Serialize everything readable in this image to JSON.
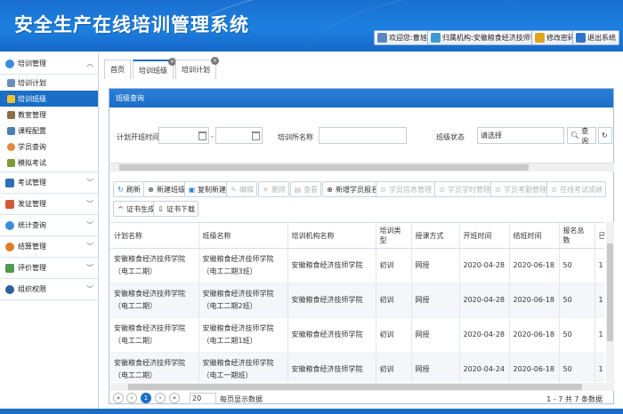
{
  "app": {
    "title": "安全生产在线培训管理系统"
  },
  "header": {
    "welcome": "欢迎您:曹旭红",
    "org": "归属机构:安徽粮食经济技师学院",
    "change_password": "修改密码",
    "logout": "退出系统"
  },
  "sidebar": {
    "groups": [
      {
        "label": "培训管理",
        "icon": "training-icon"
      },
      {
        "label": "考试管理",
        "icon": "exam-icon"
      },
      {
        "label": "发证管理",
        "icon": "certificate-icon"
      },
      {
        "label": "统计查询",
        "icon": "statistics-icon"
      },
      {
        "label": "结算管理",
        "icon": "settlement-icon"
      },
      {
        "label": "评价管理",
        "icon": "evaluation-icon"
      },
      {
        "label": "组织权限",
        "icon": "organization-icon"
      }
    ],
    "sub_items": [
      {
        "label": "培训计划",
        "active": false
      },
      {
        "label": "培训班级",
        "active": true
      },
      {
        "label": "教室管理",
        "active": false
      },
      {
        "label": "课程配置",
        "active": false
      },
      {
        "label": "学员查询",
        "active": false
      },
      {
        "label": "模拟考试",
        "active": false
      }
    ]
  },
  "tabs": [
    {
      "label": "首页",
      "closable": false,
      "active": false
    },
    {
      "label": "培训班级",
      "closable": true,
      "active": true
    },
    {
      "label": "培训计划",
      "closable": true,
      "active": false
    }
  ],
  "panel": {
    "title": "班级查询"
  },
  "filters": {
    "start_time_label": "计划开班时间",
    "date_separator": "-",
    "org_label": "培训所名称",
    "status_label": "班级状态",
    "status_value": "请选择",
    "search_label": "查询"
  },
  "toolbar": {
    "refresh": "刷新",
    "new_class": "新建班级",
    "copy_new": "复制新建",
    "edit": "编辑",
    "delete": "删除",
    "view": "查看",
    "add_student": "新增学员报名",
    "student_info": "学员信息管理",
    "student_schedule": "学员学时管理",
    "student_attendance": "学员考勤管理",
    "online_exam": "在线考试成绩",
    "cert_generate": "证书生成",
    "cert_download": "证书下载"
  },
  "table": {
    "columns": [
      "计划名称",
      "班级名称",
      "培训机构名称",
      "培训类型",
      "授课方式",
      "开班时间",
      "结班时间",
      "报名总数",
      "已"
    ],
    "rows": [
      [
        "安徽粮食经济技师学院（电工二期）",
        "安徽粮食经济技师学院（电工二期3班）",
        "安徽粮食经济技师学院",
        "初训",
        "网授",
        "2020-04-28",
        "2020-06-18",
        "50",
        "1"
      ],
      [
        "安徽粮食经济技师学院（电工二期）",
        "安徽粮食经济技师学院（电工二期2班）",
        "安徽粮食经济技师学院",
        "初训",
        "网授",
        "2020-04-28",
        "2020-06-18",
        "50",
        "1"
      ],
      [
        "安徽粮食经济技师学院（电工二期）",
        "安徽粮食经济技师学院（电工二期1班）",
        "安徽粮食经济技师学院",
        "初训",
        "网授",
        "2020-04-28",
        "2020-06-18",
        "50",
        "1"
      ],
      [
        "安徽粮食经济技师学院（电工二期）",
        "安徽粮食经济技师学院（电工一期班）",
        "安徽粮食经济技师学院",
        "初训",
        "网授",
        "2020-04-24",
        "2020-06-18",
        "50",
        "1"
      ]
    ]
  },
  "pager": {
    "current_page": "1",
    "page_size": "20",
    "per_page_label": "每页显示数据",
    "summary": "1 - 7 共 7 条数据"
  },
  "colors": {
    "primary": "#1a6ec5",
    "header": "#1d80e0"
  }
}
